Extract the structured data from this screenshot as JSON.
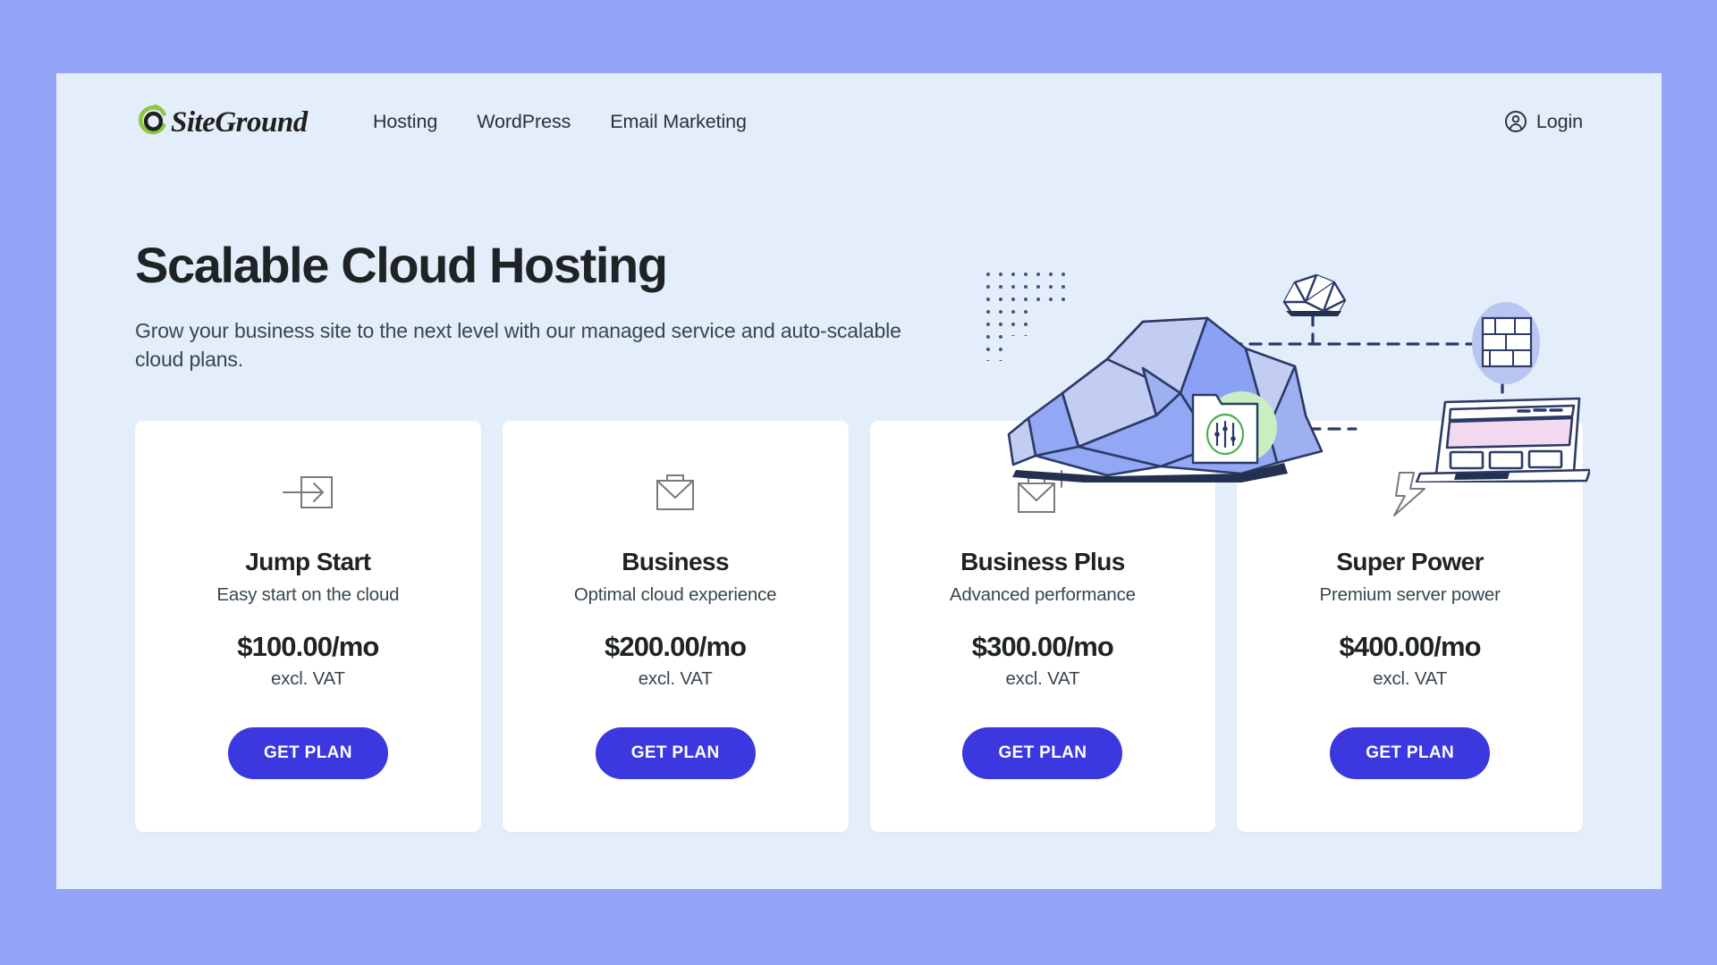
{
  "theme": {
    "outer_background": "#94a4f7",
    "page_background": "#e4edfa",
    "card_background": "#ffffff",
    "cta_color": "#3b38e0",
    "text_primary": "#1f2326",
    "text_secondary": "#37474f",
    "logo_green": "#8cc63f"
  },
  "header": {
    "brand_name": "SiteGround",
    "brand_icon": "siteground-logo-icon",
    "nav": [
      {
        "label": "Hosting"
      },
      {
        "label": "WordPress"
      },
      {
        "label": "Email Marketing"
      }
    ],
    "login": {
      "label": "Login",
      "icon": "user-circle-icon"
    }
  },
  "hero": {
    "title": "Scalable Cloud Hosting",
    "subtitle": "Grow your business site to the next level with our managed service and auto-scalable cloud plans.",
    "illustration": {
      "name": "cloud-infrastructure-illustration",
      "elements": [
        "low-poly-cloud",
        "dot-grid",
        "small-cloud-icon",
        "firewall-brick-icon",
        "settings-folder-icon",
        "laptop-browser-icon",
        "dashed-connector-lines"
      ]
    }
  },
  "plans": [
    {
      "icon": "arrow-into-box-icon",
      "name": "Jump Start",
      "tagline": "Easy start on the cloud",
      "price": "$100.00/mo",
      "vat_note": "excl. VAT",
      "cta_label": "GET PLAN"
    },
    {
      "icon": "briefcase-icon",
      "name": "Business",
      "tagline": "Optimal cloud experience",
      "price": "$200.00/mo",
      "vat_note": "excl. VAT",
      "cta_label": "GET PLAN"
    },
    {
      "icon": "briefcase-plus-icon",
      "name": "Business Plus",
      "tagline": "Advanced performance",
      "price": "$300.00/mo",
      "vat_note": "excl. VAT",
      "cta_label": "GET PLAN"
    },
    {
      "icon": "lightning-bolt-icon",
      "name": "Super Power",
      "tagline": "Premium server power",
      "price": "$400.00/mo",
      "vat_note": "excl. VAT",
      "cta_label": "GET PLAN"
    }
  ]
}
